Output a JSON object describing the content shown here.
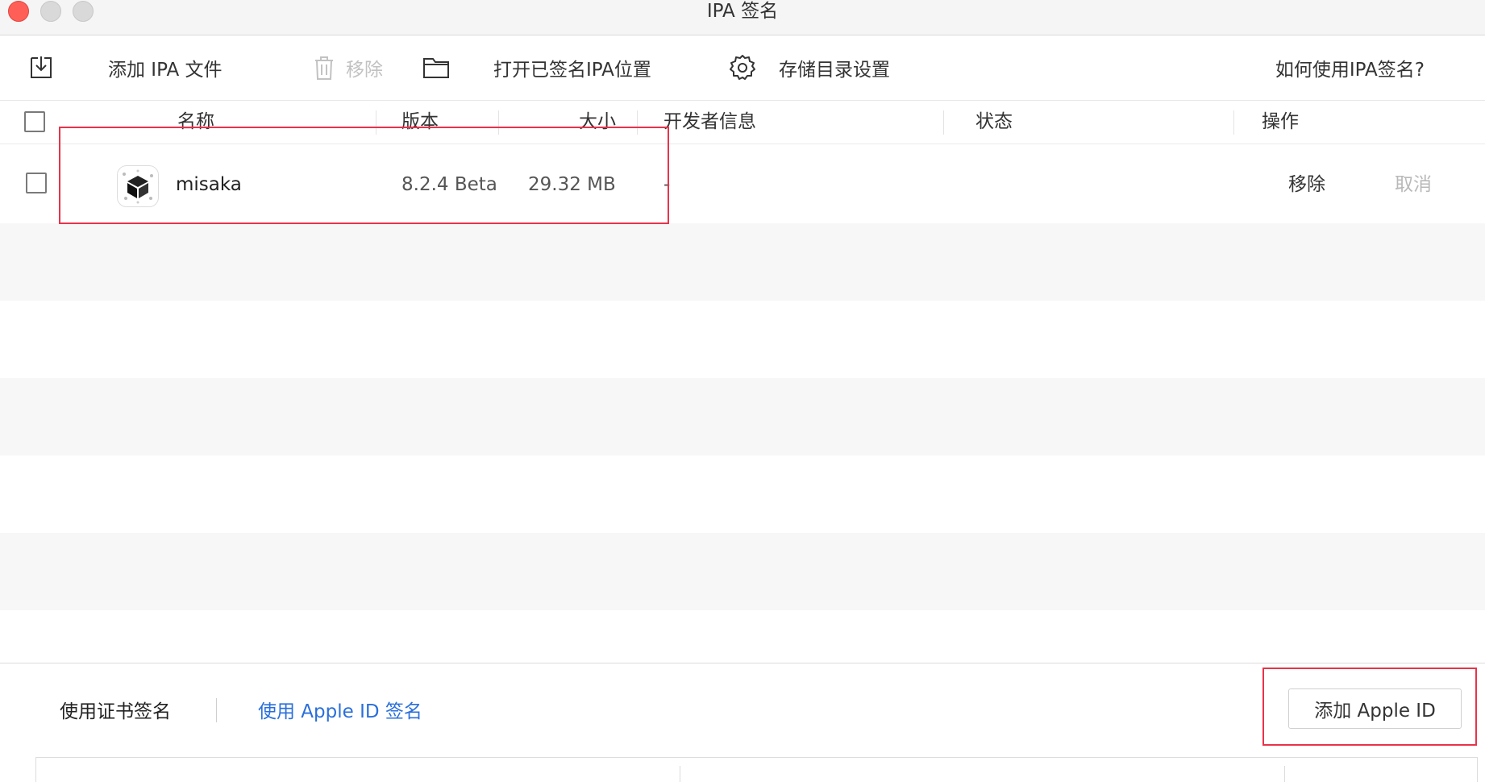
{
  "window": {
    "title": "IPA 签名"
  },
  "toolbar": {
    "add_ipa": "添加 IPA 文件",
    "remove": "移除",
    "open_signed_location": "打开已签名IPA位置",
    "storage_settings": "存储目录设置",
    "help": "如何使用IPA签名?"
  },
  "table": {
    "columns": [
      "名称",
      "版本",
      "大小",
      "开发者信息",
      "状态",
      "操作"
    ],
    "rows": [
      {
        "name": "misaka",
        "version": "8.2.4 Beta",
        "size": "29.32 MB",
        "developer": "-",
        "status": "",
        "action_remove": "移除",
        "action_cancel": "取消"
      }
    ]
  },
  "signing": {
    "tab_certificate": "使用证书签名",
    "tab_apple_id": "使用 Apple ID 签名",
    "active_tab": "tab_apple_id",
    "add_apple_id": "添加 Apple ID"
  },
  "colors": {
    "accent_link": "#2a6fdb",
    "highlight_box": "#e8334a",
    "close_button": "#ff5f57"
  }
}
